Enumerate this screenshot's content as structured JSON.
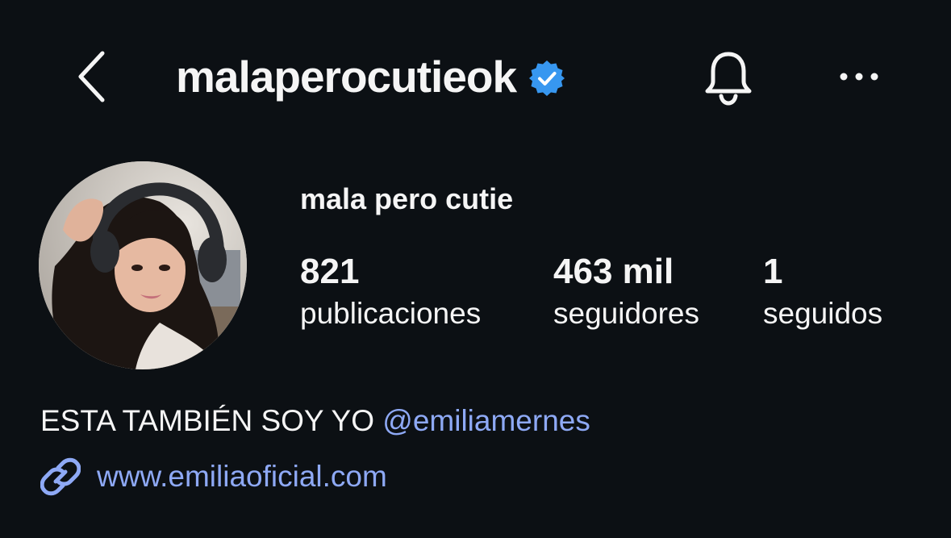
{
  "header": {
    "username": "malaperocutieok",
    "back_icon": "chevron-left-icon",
    "verified_icon": "verified-badge-icon",
    "bell_icon": "bell-icon",
    "more_icon": "more-horizontal-icon"
  },
  "profile": {
    "display_name": "mala pero cutie",
    "avatar": "profile-photo",
    "stats": [
      {
        "value": "821",
        "label": "publicaciones"
      },
      {
        "value": "463 mil",
        "label": "seguidores"
      },
      {
        "value": "1",
        "label": "seguidos"
      }
    ],
    "bio": {
      "text": "ESTA TAMBIÉN SOY YO ",
      "mention": "@emiliamernes"
    },
    "link": {
      "icon": "link-icon",
      "url": "www.emiliaoficial.com"
    }
  },
  "colors": {
    "background": "#0c1014",
    "text": "#f5f5f5",
    "link": "#8ea9f5",
    "verified": "#3797f0"
  }
}
